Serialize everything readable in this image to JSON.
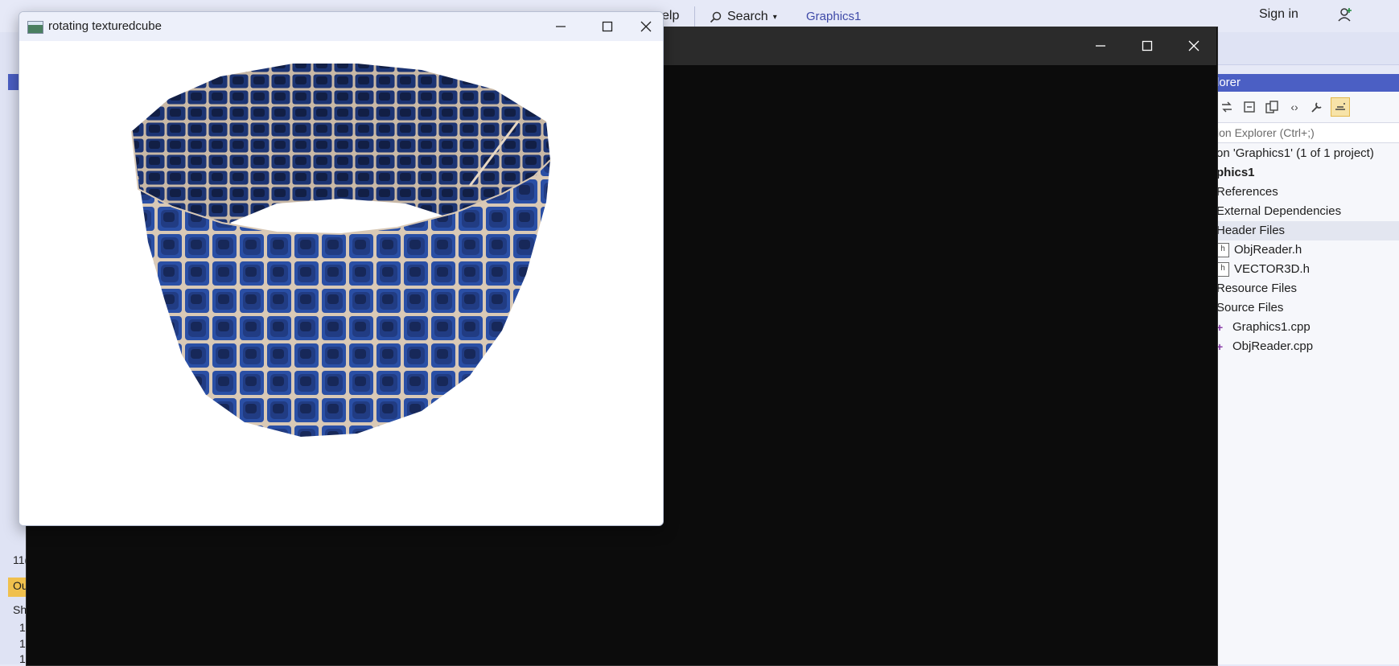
{
  "vs": {
    "menu_help": "elp",
    "search_label": "Search",
    "solution_name": "Graphics1",
    "sign_in": "Sign in",
    "left_text_1": "11(",
    "left_text_out": "Ou",
    "left_text_sh": "Sh",
    "left_text_rows": [
      "1",
      "1",
      "1"
    ],
    "accent": "#4b5fc4"
  },
  "solution_explorer": {
    "title": "lorer",
    "search_placeholder": "ion Explorer (Ctrl+;)",
    "items": [
      {
        "label": "on 'Graphics1' (1 of 1 project)"
      },
      {
        "label": "phics1"
      },
      {
        "label": "References"
      },
      {
        "label": "External Dependencies"
      },
      {
        "label": "Header Files"
      },
      {
        "label": "ObjReader.h"
      },
      {
        "label": "VECTOR3D.h"
      },
      {
        "label": "Resource Files"
      },
      {
        "label": "Source Files"
      },
      {
        "label": "Graphics1.cpp"
      },
      {
        "label": "ObjReader.cpp"
      }
    ]
  },
  "gl_window": {
    "title": "rotating texturedcube",
    "render_colors": {
      "tile_dark": "#101a3c",
      "tile_blue": "#2a4fa5",
      "grout": "#d9c9b6"
    }
  }
}
